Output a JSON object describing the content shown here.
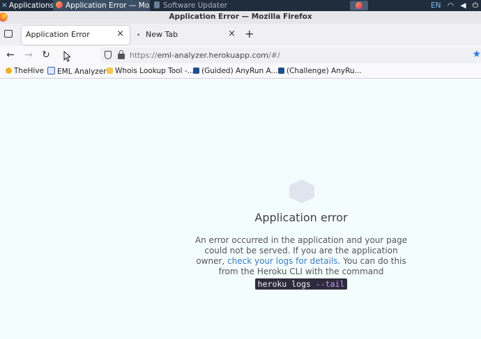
{
  "taskbar": {
    "apps_label": "Applications",
    "active_window": "Application Error — Moz...",
    "other_window": "Software Updater",
    "keyboard_layout": "EN"
  },
  "window": {
    "title": "Application Error — Mozilla Firefox"
  },
  "tabs": [
    {
      "label": "Application Error",
      "active": true
    },
    {
      "label": "New Tab",
      "active": false
    }
  ],
  "urlbar": {
    "scheme": "https://",
    "host": "eml-analyzer.herokuapp.com",
    "path": "/#/"
  },
  "bookmarks": [
    {
      "label": "TheHive",
      "icon": "thehive-icon"
    },
    {
      "label": "EML Analyzer",
      "icon": "eml-analyzer-icon"
    },
    {
      "label": "Whois Lookup Tool -...",
      "icon": "whois-icon"
    },
    {
      "label": "(Guided) AnyRun A...",
      "icon": "anyrun-icon"
    },
    {
      "label": "(Challenge) AnyRu...",
      "icon": "anyrun-icon"
    }
  ],
  "page": {
    "error_title": "Application error",
    "message_part1": "An error occurred in the application and your page could not be served. If you are the application owner, ",
    "link_text": "check your logs for details",
    "message_part2": ". You can do this from the Heroku CLI with the command",
    "command_main": "heroku logs ",
    "command_flag": "--tail"
  }
}
